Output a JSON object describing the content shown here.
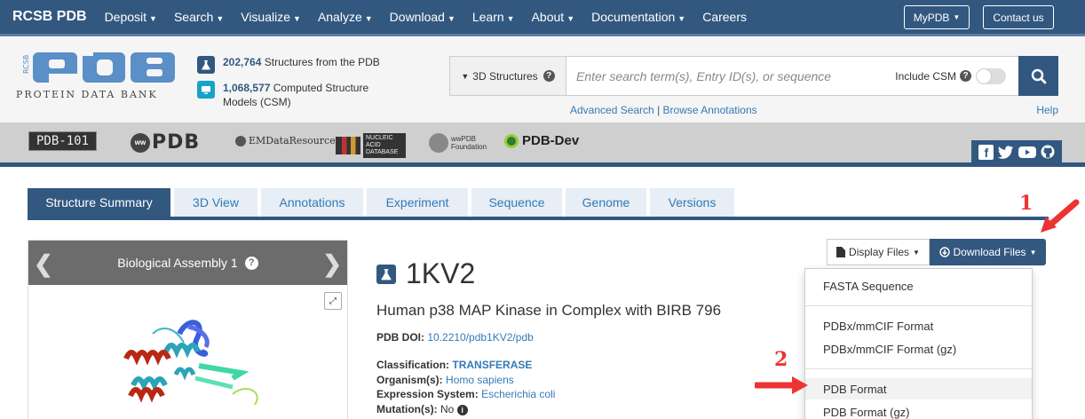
{
  "nav": {
    "brand": "RCSB PDB",
    "items": [
      "Deposit",
      "Search",
      "Visualize",
      "Analyze",
      "Download",
      "Learn",
      "About",
      "Documentation"
    ],
    "careers": "Careers",
    "mypdb": "MyPDB",
    "contact": "Contact us"
  },
  "header": {
    "logo_text": "PROTEIN DATA BANK",
    "logo_letters": "PDB",
    "logo_side": "RCSB",
    "stat1_count": "202,764",
    "stat1_text": "Structures from the PDB",
    "stat2_count": "1,068,577",
    "stat2_text": "Computed Structure",
    "stat2_text2": "Models (CSM)",
    "search_type": "3D Structures",
    "search_placeholder": "Enter search term(s), Entry ID(s), or sequence",
    "include_csm": "Include CSM",
    "advanced_search": "Advanced Search",
    "separator": "|",
    "browse_annotations": "Browse Annotations",
    "help": "Help"
  },
  "partners": {
    "pdb101": "PDB-101",
    "wwpdb": "PDB",
    "emdb": "EMDataResource",
    "nakb": "NUCLEIC ACID DATABASE",
    "wwpdb_foundation_1": "wwPDB",
    "wwpdb_foundation_2": "Foundation",
    "pdbdev": "PDB-Dev"
  },
  "tabs": [
    "Structure Summary",
    "3D View",
    "Annotations",
    "Experiment",
    "Sequence",
    "Genome",
    "Versions"
  ],
  "assembly": {
    "title": "Biological Assembly 1"
  },
  "entry": {
    "id": "1KV2",
    "title": "Human p38 MAP Kinase in Complex with BIRB 796",
    "doi_label": "PDB DOI:",
    "doi": "10.2210/pdb1KV2/pdb",
    "classification_label": "Classification:",
    "classification": "TRANSFERASE",
    "organism_label": "Organism(s):",
    "organism": "Homo sapiens",
    "expression_label": "Expression System:",
    "expression": "Escherichia coli",
    "mutation_label": "Mutation(s):",
    "mutation": "No"
  },
  "files": {
    "display": "Display Files",
    "download": "Download Files",
    "menu": [
      "FASTA Sequence",
      "PDBx/mmCIF Format",
      "PDBx/mmCIF Format (gz)",
      "PDB Format",
      "PDB Format (gz)"
    ]
  },
  "annotations": {
    "step1": "1",
    "step2": "2"
  },
  "colors": {
    "primary": "#325880",
    "link": "#337ab7",
    "accent_red": "#e33333",
    "stat1_icon": "#325880",
    "stat2_icon": "#17a2c8"
  }
}
